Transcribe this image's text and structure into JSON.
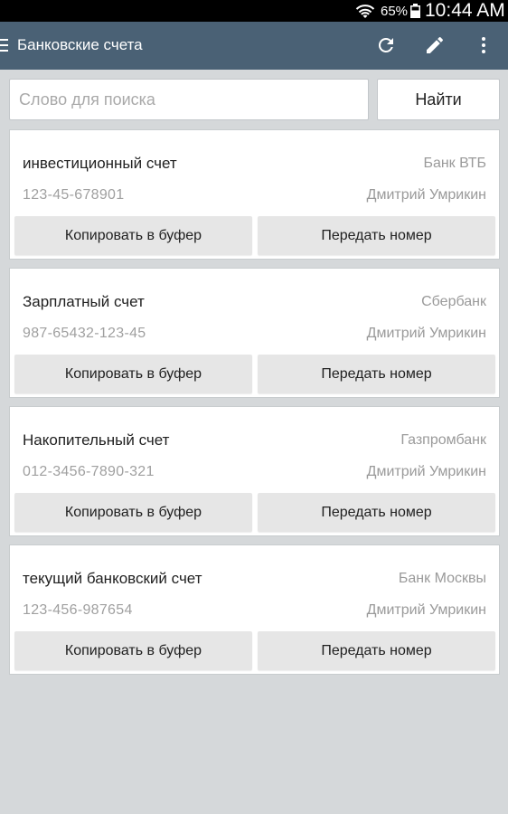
{
  "status_bar": {
    "battery_percent": "65%",
    "time": "10:44 AM",
    "icons": [
      "wifi-icon",
      "battery-icon"
    ]
  },
  "app_bar": {
    "title": "Банковские счета",
    "icons": [
      "menu-icon",
      "refresh-icon",
      "edit-icon",
      "more-vert-icon"
    ],
    "color": "#4a6175"
  },
  "search": {
    "placeholder": "Слово для поиска",
    "value": "",
    "button_label": "Найти"
  },
  "accounts": [
    {
      "name": "инвестиционный счет",
      "bank": "Банк ВТБ",
      "number": "123-45-678901",
      "owner": "Дмитрий Умрикин",
      "copy_label": "Копировать в буфер",
      "send_label": "Передать номер"
    },
    {
      "name": "Зарплатный счет",
      "bank": "Сбербанк",
      "number": "987-65432-123-45",
      "owner": "Дмитрий Умрикин",
      "copy_label": "Копировать в буфер",
      "send_label": "Передать номер"
    },
    {
      "name": "Накопительный счет",
      "bank": "Газпромбанк",
      "number": "012-3456-7890-321",
      "owner": "Дмитрий Умрикин",
      "copy_label": "Копировать в буфер",
      "send_label": "Передать номер"
    },
    {
      "name": "текущий банковский счет",
      "bank": "Банк Москвы",
      "number": "123-456-987654",
      "owner": "Дмитрий Умрикин",
      "copy_label": "Копировать в буфер",
      "send_label": "Передать номер"
    }
  ]
}
